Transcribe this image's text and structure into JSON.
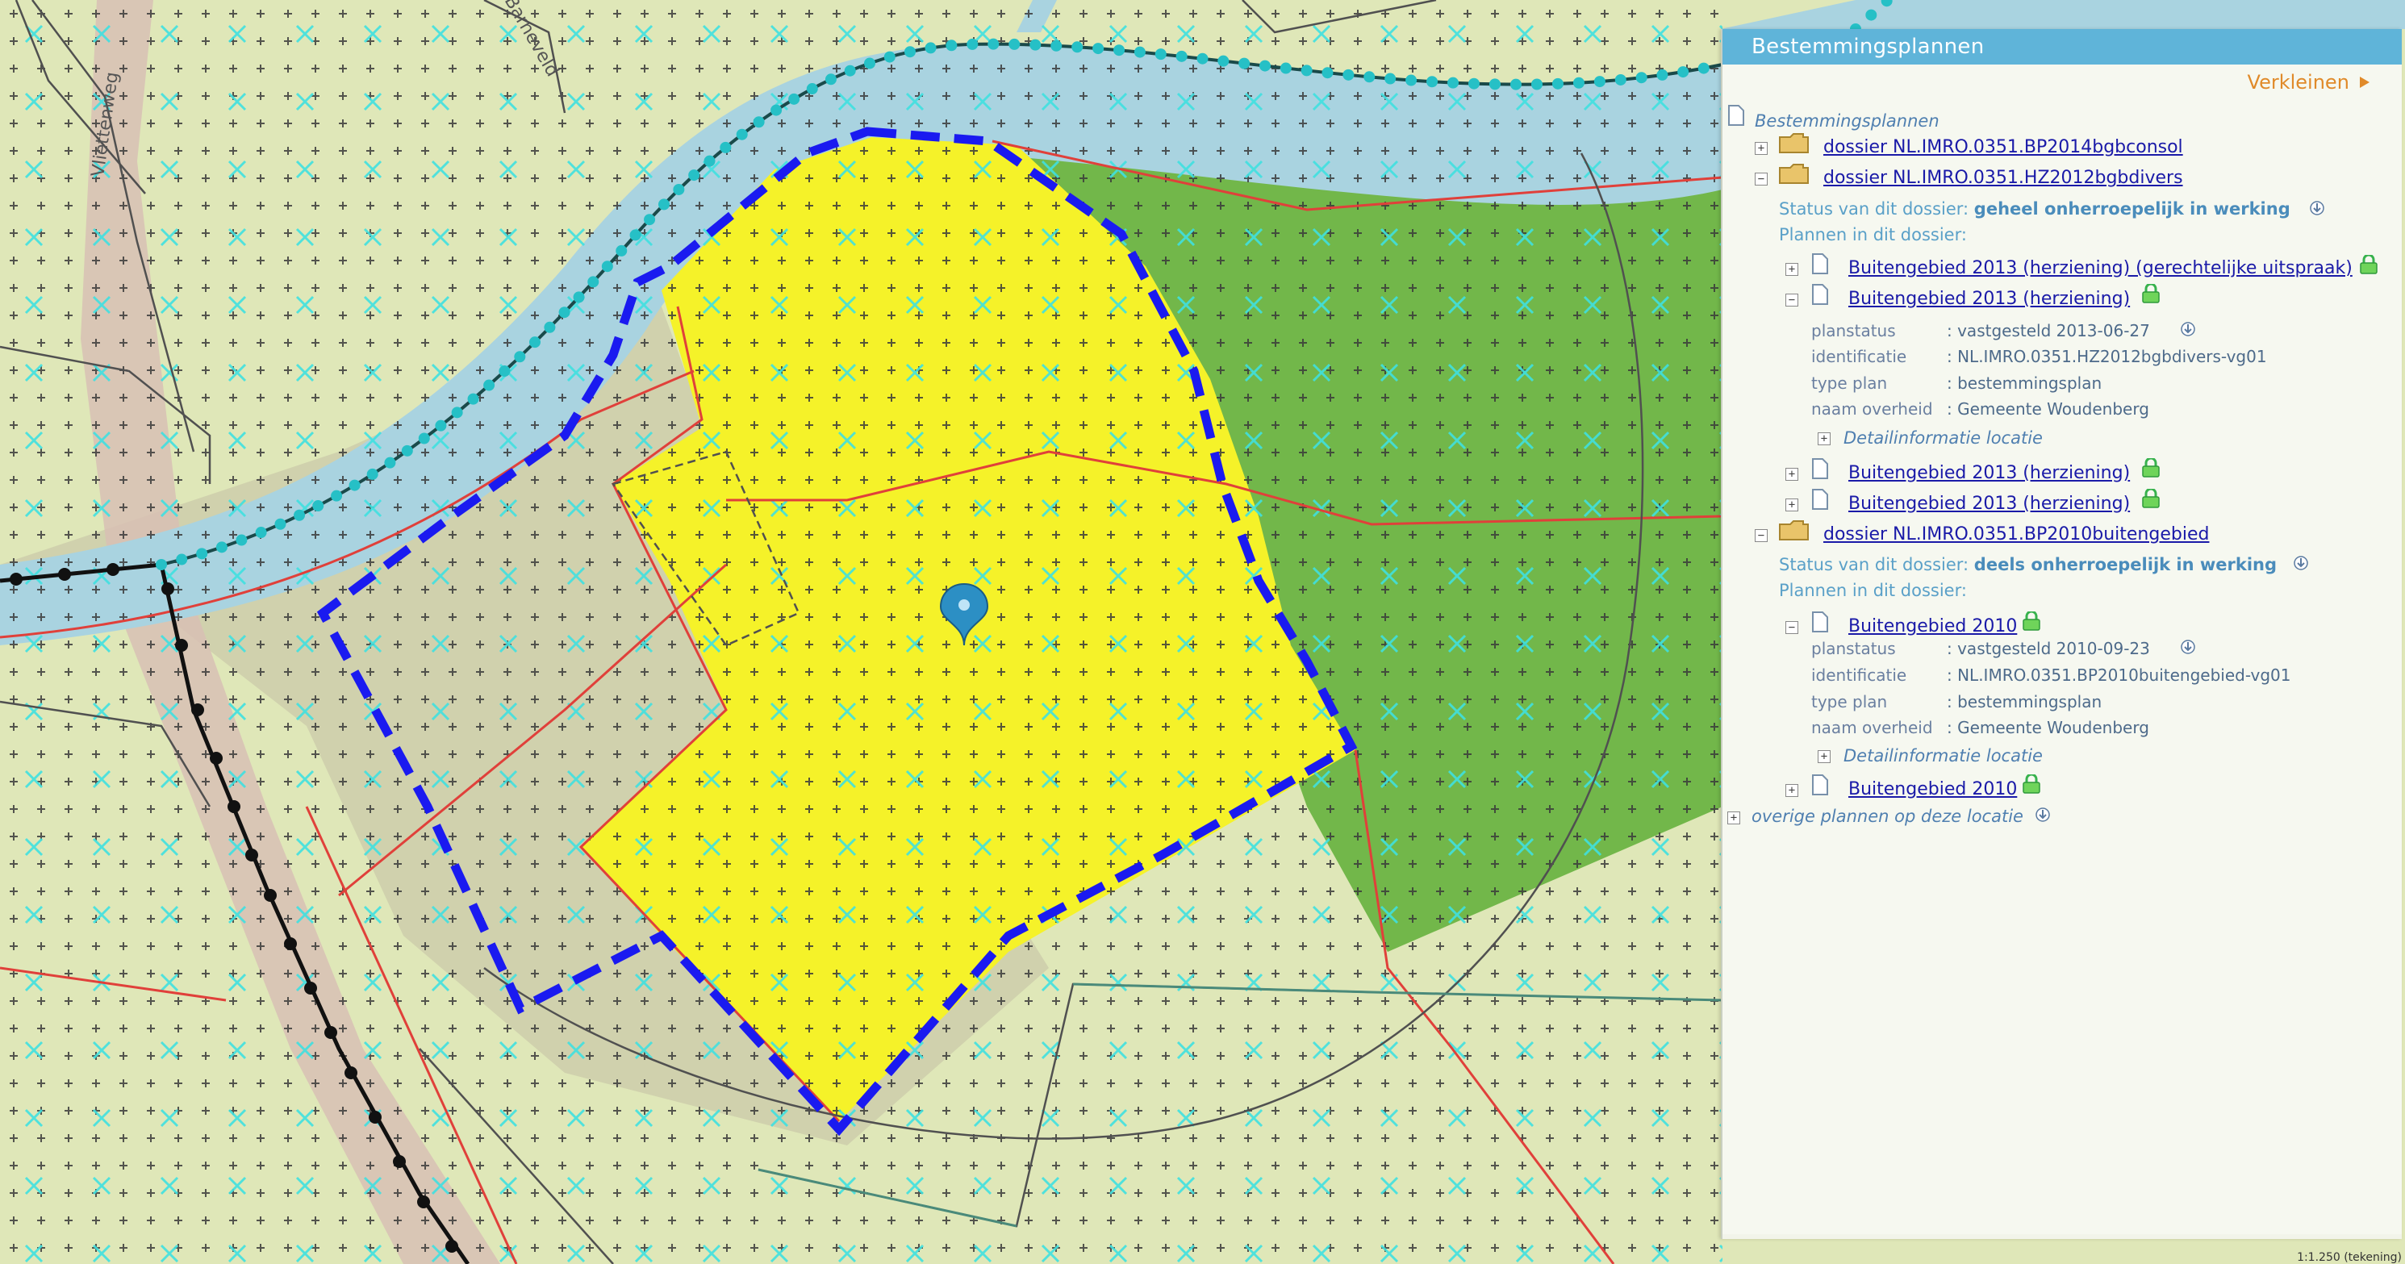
{
  "map": {
    "street_label_1": "Vliettenweg",
    "street_label_2": "Barneveld"
  },
  "panel": {
    "title": "Bestemmingsplannen",
    "collapse_label": "Verkleinen",
    "root_label": "Bestemmingsplannen",
    "dossier1": {
      "label": "dossier NL.IMRO.0351.BP2014bgbconsol"
    },
    "dossier2": {
      "label": "dossier NL.IMRO.0351.HZ2012bgbdivers",
      "status_prefix": "Status van dit dossier:",
      "status_value": "geheel onherroepelijk in werking",
      "plans_header": "Plannen in dit dossier:",
      "plan_a": "Buitengebied 2013 (herziening) (gerechtelijke uitspraak)",
      "plan_b": "Buitengebied 2013 (herziening)",
      "props": {
        "planstatus_label": "planstatus",
        "planstatus_value": ": vastgesteld 2013-06-27",
        "identificatie_label": "identificatie",
        "identificatie_value": ": NL.IMRO.0351.HZ2012bgbdivers-vg01",
        "type_label": "type plan",
        "type_value": ": bestemmingsplan",
        "overheid_label": "naam overheid",
        "overheid_value": ": Gemeente Woudenberg"
      },
      "detail_label": "Detailinformatie locatie",
      "plan_c": "Buitengebied 2013 (herziening)",
      "plan_d": "Buitengebied 2013 (herziening)"
    },
    "dossier3": {
      "label": "dossier NL.IMRO.0351.BP2010buitengebied",
      "status_prefix": "Status van dit dossier:",
      "status_value": "deels onherroepelijk in werking",
      "plans_header": "Plannen in dit dossier:",
      "plan_a": "Buitengebied 2010",
      "props": {
        "planstatus_label": "planstatus",
        "planstatus_value": ": vastgesteld 2010-09-23",
        "identificatie_label": "identificatie",
        "identificatie_value": ": NL.IMRO.0351.BP2010buitengebied-vg01",
        "type_label": "type plan",
        "type_value": ": bestemmingsplan",
        "overheid_label": "naam overheid",
        "overheid_value": ": Gemeente Woudenberg"
      },
      "detail_label": "Detailinformatie locatie",
      "plan_b": "Buitengebied 2010"
    },
    "other_plans": "overige plannen op deze locatie"
  },
  "scale_text": "1:1.250 (tekening)"
}
